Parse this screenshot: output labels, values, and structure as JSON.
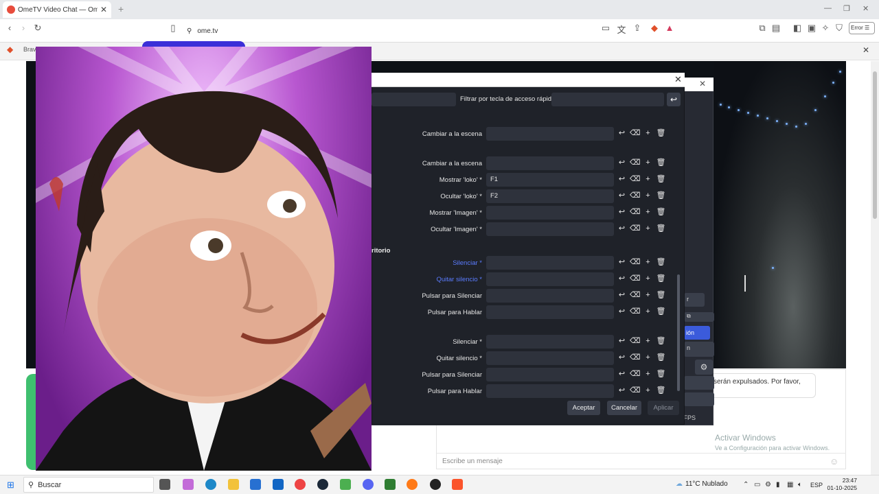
{
  "browser": {
    "tab_title": "OmeTV Video Chat — Omegle",
    "tab_close": "✕",
    "new_tab": "+",
    "url": "ome.tv",
    "error_badge": "Error",
    "infobar_text": "Brav",
    "infobar_close": "✕"
  },
  "omegle": {
    "notice_text": "serán expulsados. Por favor,",
    "message_placeholder": "Escribe un mensaje",
    "activate_title": "Activar Windows",
    "activate_sub": "Ve a Configuración para activar Windows."
  },
  "obs_back": {
    "items": [
      "r",
      "ión",
      "n"
    ],
    "fps": ") FPS"
  },
  "hotkeys_dialog": {
    "filter_label": "Filtrar por tecla de acceso rápido",
    "section_label": "ritorio",
    "rows": [
      {
        "label": "Cambiar a la escena",
        "value": "",
        "blue": false
      },
      {
        "label": "Cambiar a la escena",
        "value": "",
        "blue": false
      },
      {
        "label": "Mostrar 'loko' *",
        "value": "F1",
        "blue": false
      },
      {
        "label": "Ocultar 'loko' *",
        "value": "F2",
        "blue": false
      },
      {
        "label": "Mostrar 'Imagen' *",
        "value": "",
        "blue": false
      },
      {
        "label": "Ocultar 'Imagen' *",
        "value": "",
        "blue": false
      },
      {
        "label": "Silenciar *",
        "value": "",
        "blue": true
      },
      {
        "label": "Quitar silencio *",
        "value": "",
        "blue": true
      },
      {
        "label": "Pulsar para Silenciar",
        "value": "",
        "blue": false
      },
      {
        "label": "Pulsar para Hablar",
        "value": "",
        "blue": false
      },
      {
        "label": "Silenciar *",
        "value": "",
        "blue": false
      },
      {
        "label": "Quitar silencio *",
        "value": "",
        "blue": false
      },
      {
        "label": "Pulsar para Silenciar",
        "value": "",
        "blue": false
      },
      {
        "label": "Pulsar para Hablar",
        "value": "",
        "blue": false
      }
    ],
    "buttons": {
      "accept": "Aceptar",
      "cancel": "Cancelar",
      "apply": "Aplicar"
    }
  },
  "taskbar": {
    "search_placeholder": "Buscar",
    "weather": "11°C  Nublado",
    "lang": "ESP",
    "time": "23:47",
    "date": "01-10-2025"
  },
  "colors": {
    "dialog_bg": "#1f2229",
    "field_bg": "#2e323c",
    "accent_blue": "#5b7cff",
    "photo_purple": "#b857d0"
  }
}
